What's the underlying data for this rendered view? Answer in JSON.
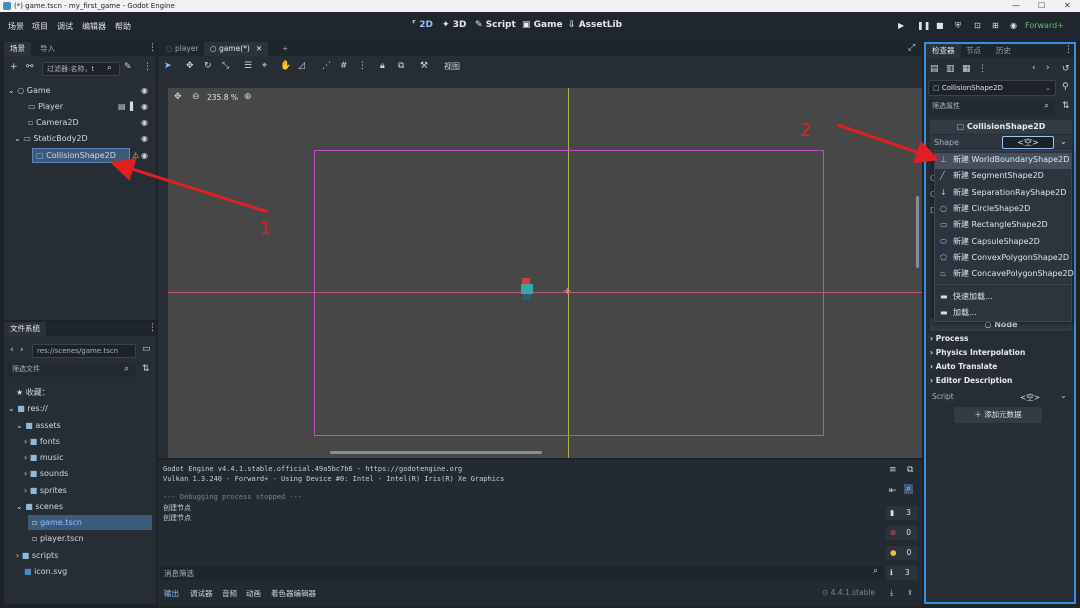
{
  "window": {
    "title": "(*) game.tscn - my_first_game - Godot Engine",
    "minimize": "—",
    "maximize": "☐",
    "close": "✕"
  },
  "menus": [
    "场景",
    "项目",
    "调试",
    "编辑器",
    "帮助"
  ],
  "modes": [
    {
      "label": "2D",
      "icon": "2d-icon"
    },
    {
      "label": "3D",
      "icon": "3d-icon"
    },
    {
      "label": "Script",
      "icon": "script-icon"
    },
    {
      "label": "Game",
      "icon": "game-icon"
    },
    {
      "label": "AssetLib",
      "icon": "assetlib-icon"
    }
  ],
  "renderer": "Forward+",
  "scene_dock": {
    "tabs": [
      "场景",
      "导入"
    ],
    "filter_placeholder": "过滤器:名称，t",
    "nodes": [
      {
        "label": "Game",
        "depth": 0
      },
      {
        "label": "Player",
        "depth": 1
      },
      {
        "label": "Camera2D",
        "depth": 1
      },
      {
        "label": "StaticBody2D",
        "depth": 1
      },
      {
        "label": "CollisionShape2D",
        "depth": 2,
        "selected": true
      }
    ]
  },
  "filesystem": {
    "tab": "文件系统",
    "path": "res://scenes/game.tscn",
    "filter_placeholder": "筛选文件",
    "favorites": "收藏：",
    "items": [
      {
        "label": "res://",
        "depth": 0,
        "type": "folder"
      },
      {
        "label": "assets",
        "depth": 1,
        "type": "folder"
      },
      {
        "label": "fonts",
        "depth": 2,
        "type": "folder"
      },
      {
        "label": "music",
        "depth": 2,
        "type": "folder"
      },
      {
        "label": "sounds",
        "depth": 2,
        "type": "folder"
      },
      {
        "label": "sprites",
        "depth": 2,
        "type": "folder"
      },
      {
        "label": "scenes",
        "depth": 1,
        "type": "folder"
      },
      {
        "label": "game.tscn",
        "depth": 2,
        "type": "scene",
        "selected": true
      },
      {
        "label": "player.tscn",
        "depth": 2,
        "type": "scene"
      },
      {
        "label": "scripts",
        "depth": 1,
        "type": "folder"
      },
      {
        "label": "icon.svg",
        "depth": 1,
        "type": "image"
      }
    ]
  },
  "editor_tabs": [
    {
      "label": "player"
    },
    {
      "label": "game(*)",
      "active": true
    }
  ],
  "toolbar": {
    "view_label": "视图"
  },
  "zoom": "235.8 %",
  "output": {
    "lines": [
      "Godot Engine v4.4.1.stable.official.49a5bc7b6 - https://godotengine.org",
      "Vulkan 1.3.240 - Forward+ - Using Device #0: Intel - Intel(R) Iris(R) Xe Graphics",
      "",
      "--- Debugging process stopped ---",
      "创建节点",
      "创建节点"
    ],
    "filter_placeholder": "消息筛选",
    "counts": {
      "log": "3",
      "errors": "0",
      "warnings": "0",
      "info": "3"
    }
  },
  "bottom_tabs": [
    "输出",
    "调试器",
    "音频",
    "动画",
    "着色器编辑器"
  ],
  "version": "4.4.1.stable",
  "inspector": {
    "tabs": [
      "检查器",
      "节点",
      "历史"
    ],
    "node_path": "CollisionShape2D",
    "filter_placeholder": "筛选属性",
    "class_title": "CollisionShape2D",
    "shape_label": "Shape",
    "shape_value": "<空>",
    "node_section": "Node",
    "sections": [
      "Process",
      "Physics Interpolation",
      "Auto Translate",
      "Editor Description"
    ],
    "script_label": "Script",
    "script_value": "<空>",
    "add_metadata": "添加元数据"
  },
  "shape_menu": [
    {
      "label": "新建 WorldBoundaryShape2D",
      "icon": "world-boundary-icon"
    },
    {
      "label": "新建 SegmentShape2D",
      "icon": "segment-icon"
    },
    {
      "label": "新建 SeparationRayShape2D",
      "icon": "separation-ray-icon"
    },
    {
      "label": "新建 CircleShape2D",
      "icon": "circle-icon"
    },
    {
      "label": "新建 RectangleShape2D",
      "icon": "rectangle-icon"
    },
    {
      "label": "新建 CapsuleShape2D",
      "icon": "capsule-icon"
    },
    {
      "label": "新建 ConvexPolygonShape2D",
      "icon": "convex-polygon-icon"
    },
    {
      "label": "新建 ConcavePolygonShape2D",
      "icon": "concave-polygon-icon"
    },
    {
      "label": "快速加载...",
      "icon": "folder-icon"
    },
    {
      "label": "加载...",
      "icon": "folder-icon"
    }
  ],
  "annotations": [
    "1",
    "2"
  ],
  "colors": {
    "accent": "#478cbf",
    "arrow": "#e02020",
    "viewport": "#474747",
    "frame": "#c24fc2"
  }
}
